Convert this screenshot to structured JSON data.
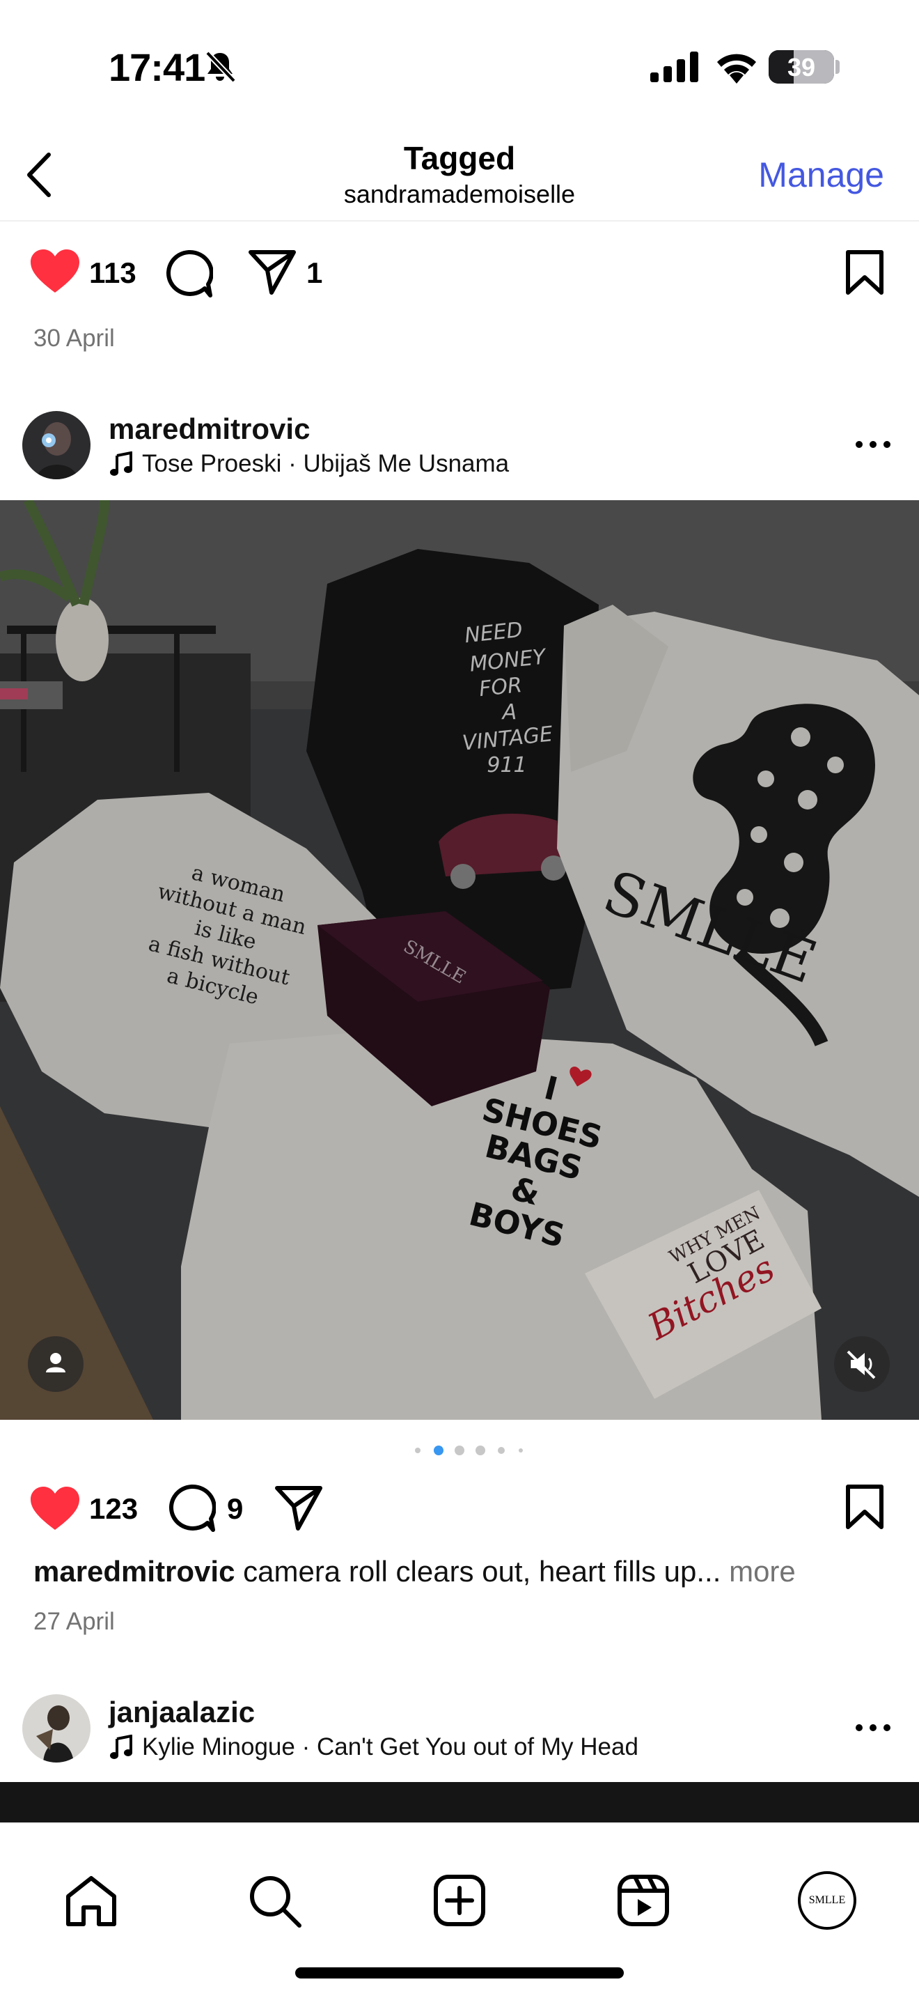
{
  "status_bar": {
    "time": "17:41",
    "battery": "39",
    "icons": [
      "bell-slash-icon",
      "signal-icon",
      "wifi-icon",
      "battery-icon"
    ]
  },
  "header": {
    "title": "Tagged",
    "subtitle": "sandramademoiselle",
    "manage_label": "Manage",
    "accent_color": "#4458e0"
  },
  "post_prev": {
    "likes": "113",
    "shares": "1",
    "date": "30 April"
  },
  "post": {
    "username": "maredmitrovic",
    "music": "Tose Proeski · Ubijaš Me Usnama",
    "likes": "123",
    "comments": "9",
    "caption_user": "maredmitrovic",
    "caption_text": " camera roll clears out, heart fills up... ",
    "caption_more": "more",
    "date": "27 April",
    "carousel_total": 6,
    "carousel_active": 2,
    "image_texts": {
      "shirt1": [
        "a woman",
        "without a man",
        "is like",
        "a fish without",
        "a bicycle"
      ],
      "shirt2": [
        "NEED",
        "MONEY",
        "FOR",
        "A",
        "VINTAGE",
        "911"
      ],
      "shirt3": [
        "SMLLE"
      ],
      "shirt4": [
        "I",
        "SHOES",
        "BAGS",
        "&",
        "BOYS"
      ],
      "box": "SMLLE",
      "book": [
        "WHY MEN",
        "LOVE",
        "Bitches"
      ]
    }
  },
  "post_next": {
    "username": "janjaalazic",
    "music": "Kylie Minogue · Can't Get You out of My Head"
  },
  "tabbar": {
    "items": [
      "home-icon",
      "search-icon",
      "create-icon",
      "reels-icon",
      "profile-avatar"
    ],
    "profile_label": "SMLLE"
  },
  "colors": {
    "like_red": "#ff3040",
    "muted_text": "#737373",
    "dot_active": "#3897f0"
  }
}
